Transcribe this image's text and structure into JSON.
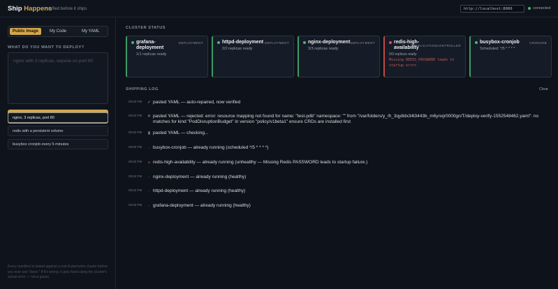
{
  "header": {
    "brand_part1": "Ship",
    "brand_part2": " Happens",
    "tagline": "verified before it ships",
    "url": "http://localhost:8000",
    "status": "connected",
    "status_color": "#46b974"
  },
  "sidebar": {
    "tabs": [
      "Public Image",
      "My Code",
      "My YAML"
    ],
    "active_tab": "Public Image",
    "question": "WHAT DO YOU WANT TO DEPLOY?",
    "prompt_placeholder": "nginx with 3 replicas, expose on port 80",
    "cta": "Generate & Verify",
    "examples": [
      "nginx, 3 replicas, port 80",
      "redis with a persistent volume",
      "busybox cronjob every 5 minutes"
    ],
    "footnote": "Every manifest is tested against a real Kubernetes cluster before you ever see \"done.\" If it's wrong, it gets fixed using the cluster's actual error — not a guess."
  },
  "cluster": {
    "title": "CLUSTER STATUS",
    "cards": [
      {
        "name": "grafana-deployment",
        "kind": "DEPLOYMENT",
        "status": "1/1 replicas ready",
        "health": "healthy",
        "error": ""
      },
      {
        "name": "httpd-deployment",
        "kind": "DEPLOYMENT",
        "status": "2/2 replicas ready",
        "health": "healthy",
        "error": ""
      },
      {
        "name": "nginx-deployment",
        "kind": "DEPLOYMENT",
        "status": "3/3 replicas ready",
        "health": "healthy",
        "error": ""
      },
      {
        "name": "redis-high-availability",
        "kind": "REPLICATIONCONTROLLER",
        "status": "0/3 replicas ready",
        "health": "unhealthy",
        "error": "Missing REDIS_PASSWORD leads to startup error."
      },
      {
        "name": "busybox-cronjob",
        "kind": "CRONJOB",
        "status": "Scheduled: */5 * * * *",
        "health": "healthy",
        "error": ""
      }
    ]
  },
  "log": {
    "title": "SHIPPING LOG",
    "clear": "Clear",
    "entries": [
      {
        "time": "05:50 PM",
        "icon": "✓",
        "text": "pasted YAML — auto-repaired, now verified"
      },
      {
        "time": "05:50 PM",
        "icon": "✕",
        "text": "pasted YAML — rejected: error: resource mapping not found for name: \"test-pdb\" namespace: \"\" from \"/var/folders/y_/h_3qy8dx34l3443b_m6ynxjr0000gn/T/deploy-verify-1552548462.yaml\": no matches for kind \"PodDisruptionBudget\" in version \"policy/v1beta1\" ensure CRDs are installed first"
      },
      {
        "time": "05:50 PM",
        "icon": "⧗",
        "text": "pasted YAML — checking..."
      },
      {
        "time": "05:50 PM",
        "icon": "·",
        "text": "busybox-cronjob — already running (scheduled */5 * * * *)"
      },
      {
        "time": "05:50 PM",
        "icon": "●",
        "text": "redis-high-availability — already running (unhealthy — Missing Redis PASSWORD leads to startup failure.)"
      },
      {
        "time": "05:50 PM",
        "icon": "·",
        "text": "nginx-deployment — already running (healthy)"
      },
      {
        "time": "05:50 PM",
        "icon": "·",
        "text": "httpd-deployment — already running (healthy)"
      },
      {
        "time": "05:50 PM",
        "icon": "·",
        "text": "grafana-deployment — already running (healthy)"
      }
    ]
  }
}
